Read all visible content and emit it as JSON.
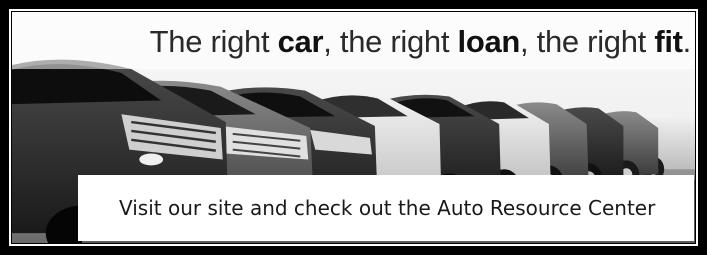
{
  "banner": {
    "headline": {
      "part1": "The right ",
      "bold1": "car",
      "part2": ", the right ",
      "bold2": "loan",
      "part3": ", the right ",
      "bold3": "fit",
      "part4": "."
    },
    "cta_label": "Visit our site and check out the Auto Resource Center",
    "image_subject": "row-of-parked-cars"
  },
  "colors": {
    "frame": "#000000",
    "headline_text": "#2a2a2a",
    "cta_background": "#ffffff",
    "cta_shadow": "#5a5a5a"
  }
}
